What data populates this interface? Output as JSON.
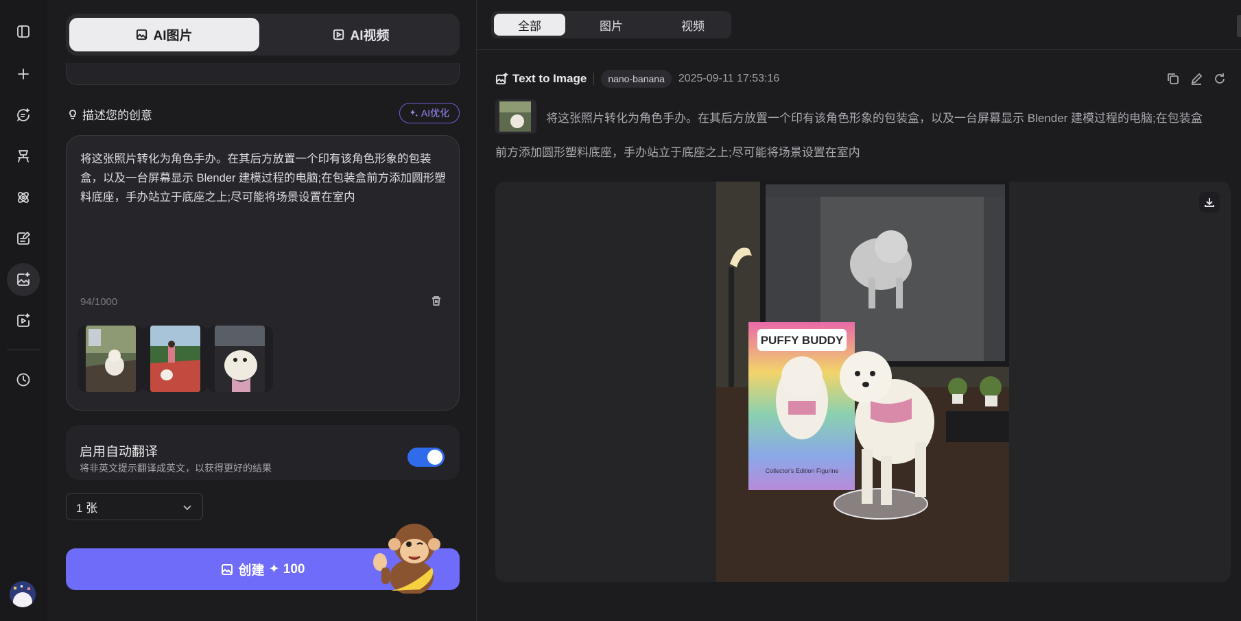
{
  "rail": {
    "items": [
      {
        "icon": "sidebar-toggle-icon"
      },
      {
        "icon": "plus-icon"
      },
      {
        "icon": "chat-sparkle-icon"
      },
      {
        "icon": "chair-icon"
      },
      {
        "icon": "atom-icon"
      },
      {
        "icon": "edit-doc-icon"
      },
      {
        "icon": "image-sparkle-icon",
        "active": true
      },
      {
        "icon": "video-sparkle-icon"
      },
      {
        "icon": "history-clock-icon"
      }
    ]
  },
  "mode_switch": {
    "image_label": "AI图片",
    "video_label": "AI视频",
    "active": "image"
  },
  "prompt_section": {
    "title": "描述您的创意",
    "ai_optimize_label": "AI优化",
    "text": "将这张照片转化为角色手办。在其后方放置一个印有该角色形象的包装盒，以及一台屏幕显示 Blender 建模过程的电脑;在包装盒前方添加圆形塑料底座，手办站立于底座之上;尽可能将场景设置在室内",
    "char_count": "94/1000"
  },
  "translate": {
    "title": "启用自动翻译",
    "subtitle": "将非英文提示翻译成英文，以获得更好的结果",
    "enabled": true,
    "accent": "#2f6bea"
  },
  "count_select": {
    "value": "1 张"
  },
  "create_button": {
    "label": "创建",
    "cost": "✦ 100",
    "color": "#6f6cf9"
  },
  "filter_tabs": [
    {
      "label": "全部",
      "active": true
    },
    {
      "label": "图片",
      "active": false
    },
    {
      "label": "视频",
      "active": false
    }
  ],
  "result": {
    "type_label": "Text to Image",
    "model": "nano-banana",
    "timestamp": "2025-09-11 17:53:16",
    "prompt_line1": "将这张照片转化为角色手办。在其后方放置一个印有该角色形象的包装盒，以及一台屏幕显示 Blender 建模过程的电脑;在包装盒",
    "prompt_line2": "前方添加圆形塑料底座，手办站立于底座之上;尽可能将场景设置在室内",
    "box_brand": "PUFFY BUDDY",
    "box_caption": "Collector's Edition Figurine"
  }
}
